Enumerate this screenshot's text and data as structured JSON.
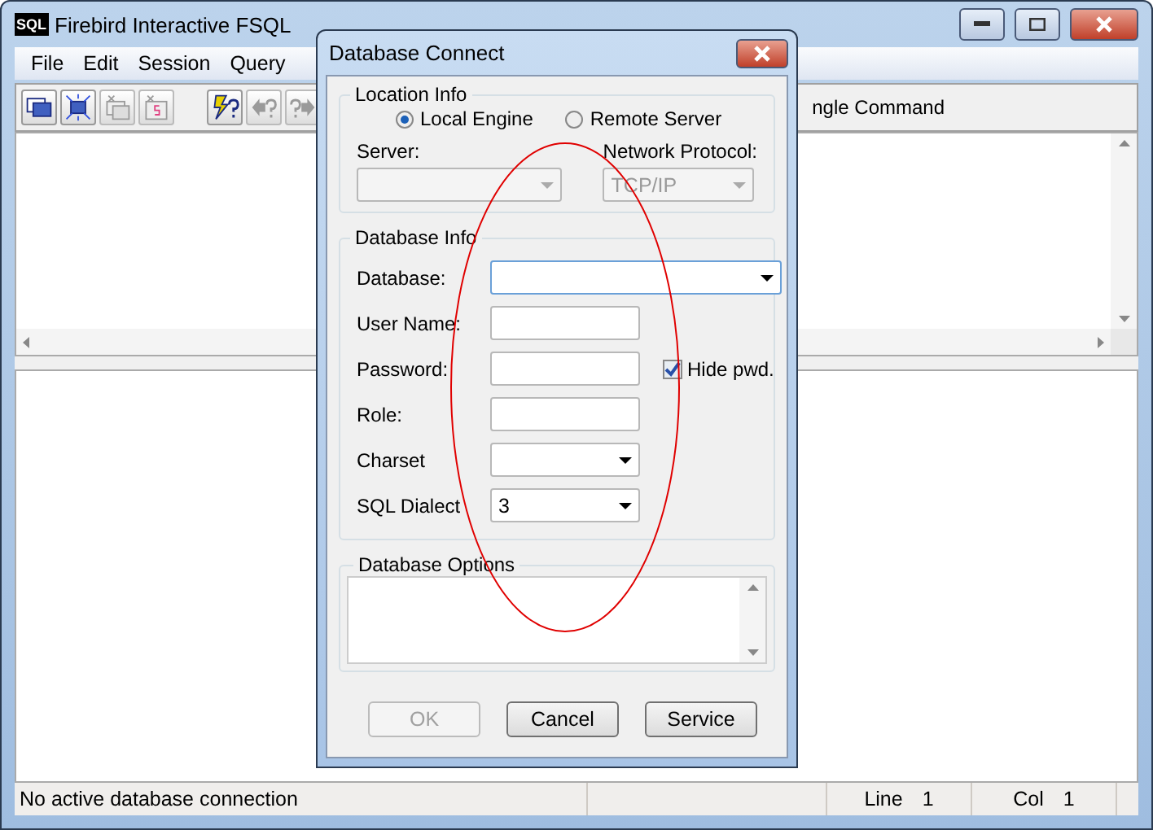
{
  "window": {
    "icon_text": "SQL",
    "title": "Firebird Interactive FSQL"
  },
  "menu": [
    {
      "label": "File"
    },
    {
      "label": "Edit"
    },
    {
      "label": "Session"
    },
    {
      "label": "Query"
    }
  ],
  "toolbar": {
    "buttons": [
      {
        "kind": "connect",
        "disabled": false
      },
      {
        "kind": "disconnect",
        "disabled": false
      },
      {
        "kind": "commit",
        "disabled": true
      },
      {
        "kind": "rollback",
        "disabled": true
      },
      {
        "kind": "execute",
        "disabled": false
      },
      {
        "kind": "previous",
        "disabled": true
      },
      {
        "kind": "next",
        "disabled": true
      }
    ],
    "partial_text": "ngle Command"
  },
  "status_bar": {
    "message": "No active database connection",
    "line_label": "Line",
    "line": "1",
    "col_label": "Col",
    "col": "1"
  },
  "dialog": {
    "title": "Database Connect",
    "location": {
      "title": "Location Info",
      "options": [
        {
          "label": "Local Engine",
          "selected": true
        },
        {
          "label": "Remote Server",
          "selected": false
        }
      ],
      "server": {
        "label": "Server:",
        "disabled": true
      },
      "protocol": {
        "label": "Network Protocol:",
        "value": "TCP/IP",
        "disabled": true
      }
    },
    "info": {
      "title": "Database Info",
      "fields": [
        {
          "kind": "combo-wide",
          "label": "Database:",
          "focused": true
        },
        {
          "kind": "text",
          "label": "User Name:"
        },
        {
          "kind": "text",
          "label": "Password:"
        },
        {
          "kind": "text",
          "label": "Role:"
        },
        {
          "kind": "combo",
          "label": "Charset"
        },
        {
          "kind": "combo",
          "label": "SQL Dialect",
          "value": "3"
        }
      ],
      "hide_password": {
        "label": "Hide pwd.",
        "checked": true
      }
    },
    "options": {
      "title": "Database Options"
    },
    "buttons": [
      {
        "label": "OK",
        "disabled": true
      },
      {
        "label": "Cancel",
        "disabled": false
      },
      {
        "label": "Service",
        "disabled": false
      }
    ]
  }
}
